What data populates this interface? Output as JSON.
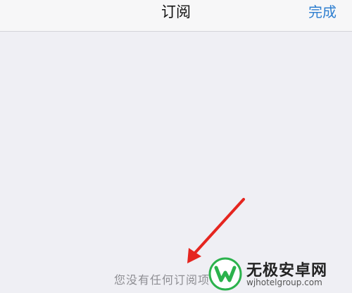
{
  "navbar": {
    "title": "订阅",
    "done_label": "完成"
  },
  "content": {
    "empty_message": "您没有任何订阅项"
  },
  "watermark": {
    "title": "无极安卓网",
    "url": "wjhotelgroup.com"
  },
  "colors": {
    "accent": "#2f7fd0",
    "background": "#efeff4",
    "arrow": "#e5251f",
    "logo_green": "#2bb24c"
  }
}
